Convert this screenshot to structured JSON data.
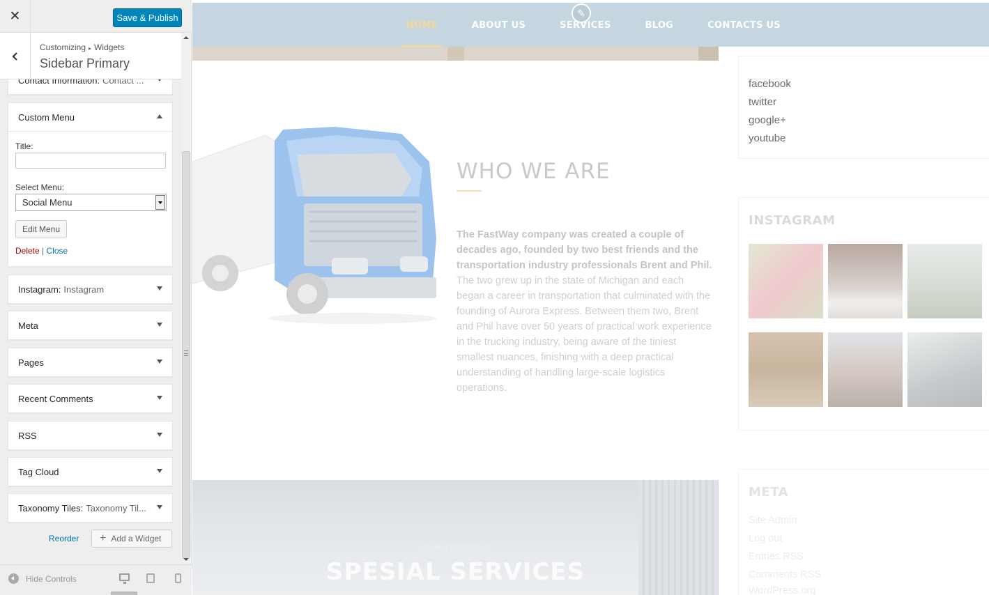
{
  "customizer": {
    "close_label": "✕",
    "publish_label": "Save & Publish",
    "breadcrumb": {
      "root": "Customizing",
      "separator": "▸",
      "parent": "Widgets"
    },
    "section_title": "Sidebar Primary",
    "widgets": [
      {
        "name": "Contact Information:",
        "subtitle": "Contact ...",
        "expanded": false
      },
      {
        "name": "Custom Menu",
        "subtitle": "",
        "expanded": true
      },
      {
        "name": "Instagram:",
        "subtitle": "Instagram",
        "expanded": false
      },
      {
        "name": "Meta",
        "subtitle": "",
        "expanded": false
      },
      {
        "name": "Pages",
        "subtitle": "",
        "expanded": false
      },
      {
        "name": "Recent Comments",
        "subtitle": "",
        "expanded": false
      },
      {
        "name": "RSS",
        "subtitle": "",
        "expanded": false
      },
      {
        "name": "Tag Cloud",
        "subtitle": "",
        "expanded": false
      },
      {
        "name": "Taxonomy Tiles:",
        "subtitle": "Taxonomy Til...",
        "expanded": false
      }
    ],
    "custom_menu_form": {
      "title_label": "Title:",
      "title_value": "",
      "select_label": "Select Menu:",
      "selected_menu": "Social Menu",
      "edit_menu_label": "Edit Menu",
      "delete_label": "Delete",
      "divider": "|",
      "close_label": "Close"
    },
    "reorder_label": "Reorder",
    "add_widget_label": "Add a Widget",
    "hide_controls_label": "Hide Controls"
  },
  "preview": {
    "nav": [
      "HOME",
      "ABOUT US",
      "SERVICES",
      "BLOG",
      "CONTACTS US"
    ],
    "active_nav": "HOME",
    "about": {
      "title": "WHO WE ARE",
      "lead": "The FastWay company was created a couple of decades ago, founded by two best  friends and the transportation industry professionals Brent and Phil.",
      "body": "The two grew up in the state of Michigan and each began a career in transportation that culminated with the founding of Aurora Express. Between them two, Brent and Phil have over 50 years of practical work experience in the trucking industry, being aware of the tiniest smallest nuances, finishing with a deep practical understanding of handling large-scale logistics operations."
    },
    "services": {
      "eyebrow": "OUR SERVICES",
      "title": "SPESIAL SERVICES"
    },
    "social_links": [
      "facebook",
      "twitter",
      "google+",
      "youtube"
    ],
    "instagram_title": "INSTAGRAM",
    "meta_title": "META",
    "meta_links": [
      "Site Admin",
      "Log out",
      "Entries RSS",
      "Comments RSS",
      "WordPress.org"
    ]
  },
  "colors": {
    "publish": "#0085ba",
    "nav_bg": "#c5d6e0",
    "nav_active": "#f5d79a",
    "truck_blue": "#8fb8e6",
    "delete": "#aa0000",
    "link": "#0073aa"
  }
}
